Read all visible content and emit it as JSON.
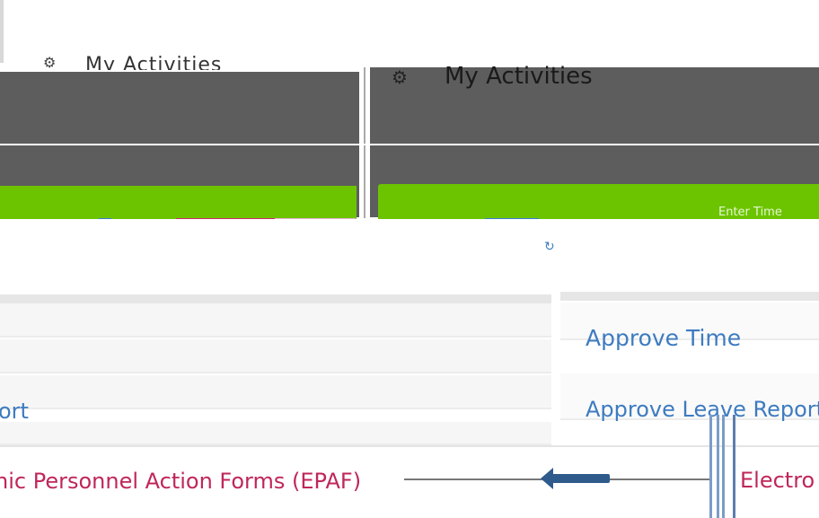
{
  "header": {
    "ghost_title": "My Activities",
    "ghost_icon": "gear-icon"
  },
  "panel": {
    "title": "My Activities",
    "icon": "gear-icon"
  },
  "green_bar": {
    "label": "Enter Time"
  },
  "links": {
    "approve_time": "Approve Time",
    "approve_leave": "Approve Leave Report",
    "leave_report_fragment": "ort",
    "epaf": "nic Personnel Action Forms (EPAF)",
    "electronic_fragment": "Electro"
  },
  "colors": {
    "dark_panel": "#5d5d5d",
    "green": "#6cc400",
    "link_blue": "#3d7bc0",
    "epaf_magenta": "#c0265a",
    "arrow": "#2e5a8c"
  }
}
